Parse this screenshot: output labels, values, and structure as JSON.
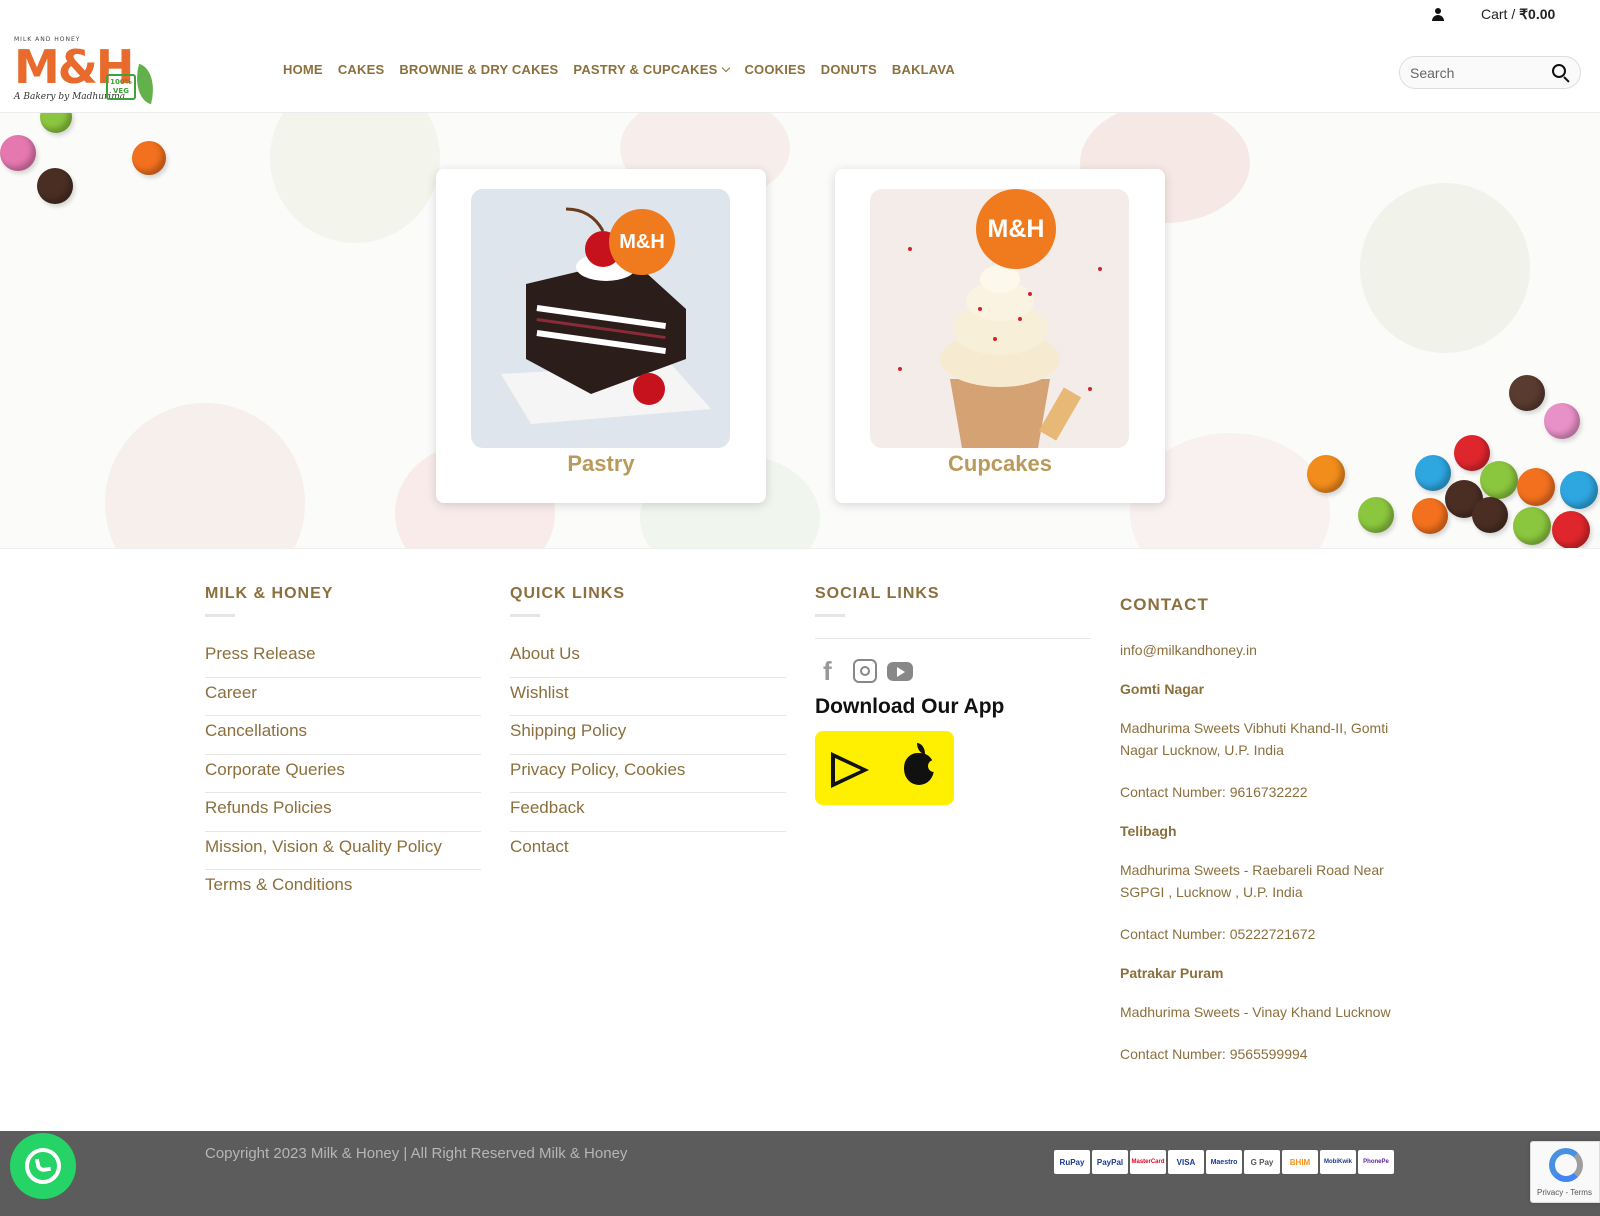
{
  "header": {
    "logo": {
      "small_text": "MILK AND HONEY",
      "mark": "M&H",
      "tagline": "A Bakery by Madhurima",
      "veg_badge": "100% VEG"
    },
    "nav": [
      {
        "label": "HOME"
      },
      {
        "label": "CAKES"
      },
      {
        "label": "BROWNIE & DRY CAKES"
      },
      {
        "label": "PASTRY & CUPCAKES"
      },
      {
        "label": "COOKIES"
      },
      {
        "label": "DONUTS"
      },
      {
        "label": "BAKLAVA"
      }
    ],
    "cart_label": "Cart /",
    "cart_total": "₹0.00",
    "search_placeholder": "Search"
  },
  "hero": {
    "cards": [
      {
        "title": "Pastry",
        "badge": "M&H"
      },
      {
        "title": "Cupcakes",
        "badge": "M&H"
      }
    ]
  },
  "footer": {
    "col1": {
      "title": "MILK & HONEY",
      "links": [
        "Press Release",
        "Career",
        "Cancellations",
        "Corporate Queries",
        "Refunds Policies",
        "Mission, Vision & Quality Policy",
        "Terms & Conditions"
      ]
    },
    "col2": {
      "title": "QUICK LINKS",
      "links": [
        "About Us",
        "Wishlist",
        "Shipping Policy",
        "Privacy Policy, Cookies",
        "Feedback",
        "Contact"
      ]
    },
    "col3": {
      "title": "SOCIAL LINKS",
      "icons": [
        "facebook-icon",
        "instagram-icon",
        "youtube-icon"
      ],
      "app_title": "Download Our App"
    },
    "contact": {
      "title": "CONTACT",
      "email": "info@milkandhoney.in",
      "locations": [
        {
          "name": "Gomti Nagar",
          "address": "Madhurima Sweets Vibhuti Khand-II, Gomti Nagar Lucknow, U.P. India",
          "phone": "Contact Number: 9616732222"
        },
        {
          "name": "Telibagh",
          "address": "Madhurima Sweets - Raebareli Road Near SGPGI , Lucknow , U.P. India",
          "phone": "Contact Number: 05222721672"
        },
        {
          "name": "Patrakar Puram",
          "address": "Madhurima Sweets - Vinay Khand Lucknow",
          "phone": "Contact Number: 9565599994"
        }
      ]
    }
  },
  "bottom": {
    "copyright": "Copyright 2023 Milk & Honey | All Right Reserved Milk & Honey",
    "payments": [
      "RuPay",
      "PayPal",
      "MasterCard",
      "VISA",
      "Maestro",
      "G Pay",
      "BHIM",
      "MobiKwik",
      "PhonePe"
    ]
  },
  "recaptcha": {
    "text": "Privacy - Terms"
  },
  "colors": {
    "accent": "#8b6f3c",
    "brand": "#e86a2c",
    "app_box": "#ffef00",
    "whatsapp": "#25d366",
    "bottom_bar": "#5c5c5c"
  }
}
